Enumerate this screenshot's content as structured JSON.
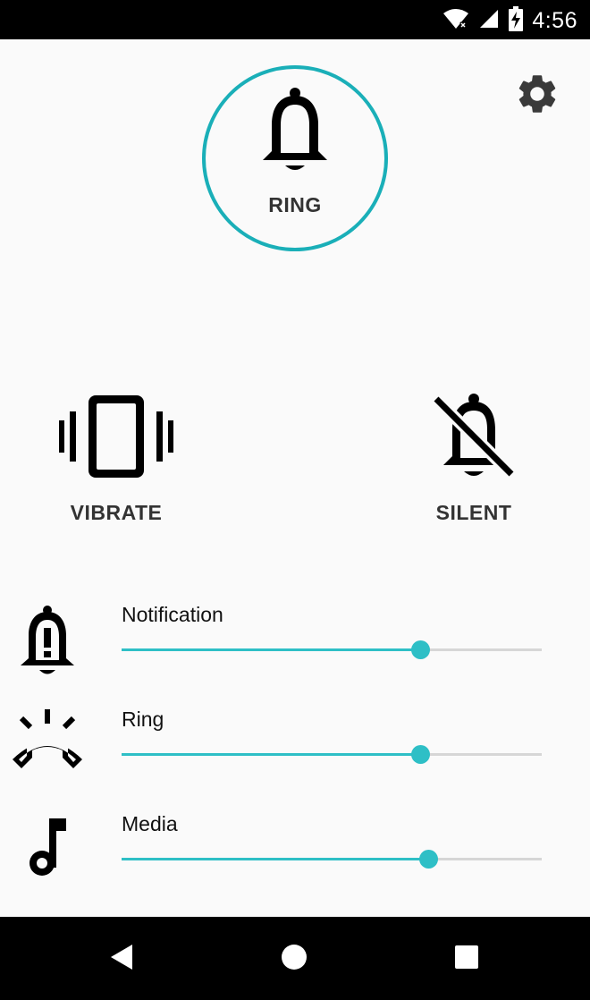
{
  "status_bar": {
    "time": "4:56",
    "icons": [
      "wifi-icon",
      "cell-signal-icon",
      "battery-charging-icon"
    ]
  },
  "header": {
    "settings_icon": "gear-icon"
  },
  "modes": {
    "selected": "ring",
    "ring": {
      "label": "RING",
      "icon": "bell-icon"
    },
    "vibrate": {
      "label": "VIBRATE",
      "icon": "vibrate-icon"
    },
    "silent": {
      "label": "SILENT",
      "icon": "bell-off-icon"
    }
  },
  "volumes": [
    {
      "label": "Notification",
      "icon": "notification-alert-icon",
      "level": 0.71
    },
    {
      "label": "Ring",
      "icon": "phone-ringing-icon",
      "level": 0.71
    },
    {
      "label": "Media",
      "icon": "music-note-icon",
      "level": 0.73
    }
  ],
  "colors": {
    "accent": "#2ebfc6",
    "ring_border": "#1aafb8",
    "track": "#d6d6d6",
    "text": "#333333"
  },
  "nav_bar": {
    "back_icon": "back-triangle-icon",
    "home_icon": "home-circle-icon",
    "recents_icon": "recents-square-icon"
  }
}
